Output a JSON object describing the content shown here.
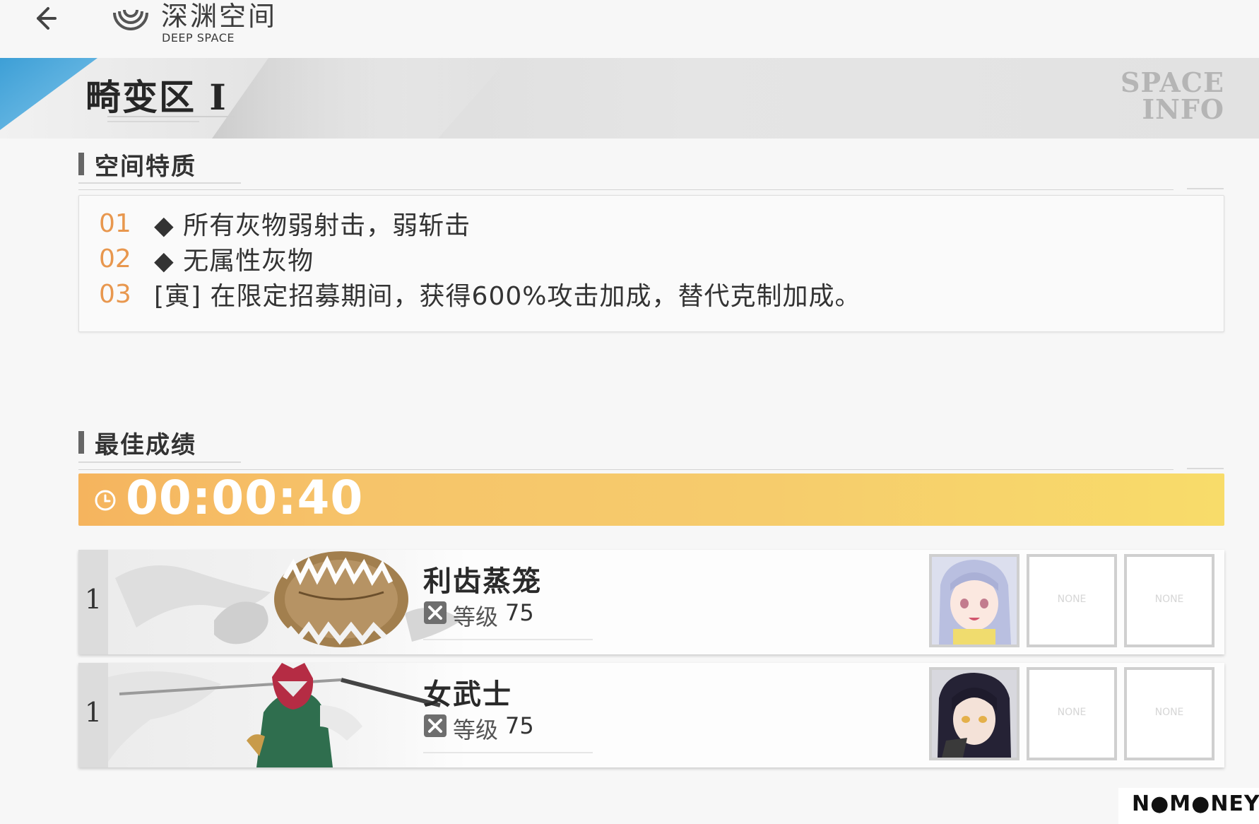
{
  "header": {
    "title": "深渊空间",
    "subtitle": "DEEP SPACE"
  },
  "zone": {
    "name": "畸变区 I",
    "badge": "SPACE INFO",
    "badge_line1": "SPACE",
    "badge_line2": "INFO"
  },
  "traits": {
    "heading": "空间特质",
    "items": [
      {
        "num": "01",
        "text": "◆ 所有灰物弱射击，弱斩击"
      },
      {
        "num": "02",
        "text": "◆ 无属性灰物"
      },
      {
        "num": "03",
        "text": "[寅] 在限定招募期间，获得600%攻击加成，替代克制加成。"
      }
    ]
  },
  "best": {
    "heading": "最佳成绩",
    "time": "00:00:40",
    "records": [
      {
        "rank": "1",
        "name": "利齿蒸笼",
        "level_label": "等级",
        "level": "75",
        "slots": [
          "avatar",
          "NONE",
          "NONE"
        ]
      },
      {
        "rank": "1",
        "name": "女武士",
        "level_label": "等级",
        "level": "75",
        "slots": [
          "avatar",
          "NONE",
          "NONE"
        ]
      }
    ]
  },
  "watermark": "N●M●NEY",
  "colors": {
    "accent_orange": "#e8974e",
    "time_bar_start": "#f5b45e",
    "time_bar_end": "#f8dc6a",
    "banner_blue": "#4aa6d8"
  },
  "icons": {
    "back": "arrow-left-icon",
    "logo": "concentric-circles-logo-icon",
    "clock": "clock-icon",
    "level": "crossed-box-icon"
  }
}
